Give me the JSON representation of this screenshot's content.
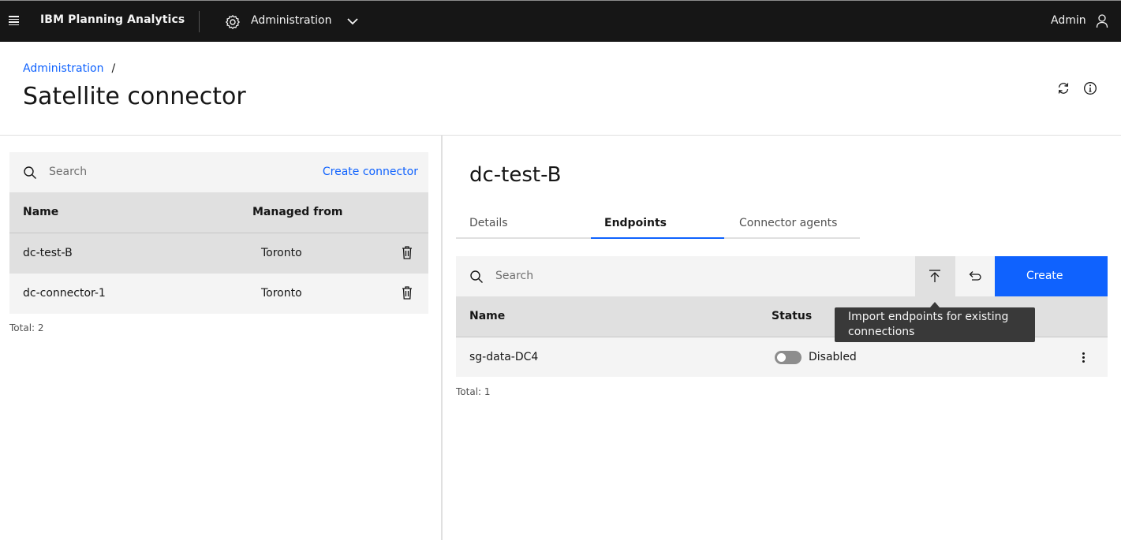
{
  "topbar": {
    "product_name": "IBM Planning Analytics",
    "area": "Administration",
    "user": "Admin"
  },
  "breadcrumb": {
    "parent": "Administration",
    "separator": "/"
  },
  "page_title": "Satellite connector",
  "connectors": {
    "search_placeholder": "Search",
    "create_link": "Create connector",
    "columns": [
      "Name",
      "Managed from"
    ],
    "rows": [
      {
        "name": "dc-test-B",
        "managed_from": "Toronto",
        "selected": true
      },
      {
        "name": "dc-connector-1",
        "managed_from": "Toronto",
        "selected": false
      }
    ],
    "total": "Total: 2"
  },
  "detail": {
    "title": "dc-test-B",
    "tabs": [
      {
        "label": "Details",
        "active": false
      },
      {
        "label": "Endpoints",
        "active": true
      },
      {
        "label": "Connector agents",
        "active": false
      }
    ],
    "endpoints": {
      "search_placeholder": "Search",
      "create_label": "Create",
      "columns": [
        "Name",
        "Status"
      ],
      "rows": [
        {
          "name": "sg-data-DC4",
          "status": "Disabled",
          "enabled": false
        }
      ],
      "total": "Total: 1",
      "tooltip": "Import endpoints for existing connections"
    }
  },
  "colors": {
    "accent": "#0f62fe",
    "topbar_bg": "#161616",
    "header_row_bg": "#e0e0e0",
    "field_bg": "#f4f4f4",
    "tooltip_bg": "#393939"
  },
  "icons": [
    "hamburger-icon",
    "gear-icon",
    "chevron-down-icon",
    "user-icon",
    "refresh-icon",
    "info-icon",
    "search-icon",
    "trash-icon",
    "import-icon",
    "undo-icon",
    "overflow-menu-icon"
  ]
}
